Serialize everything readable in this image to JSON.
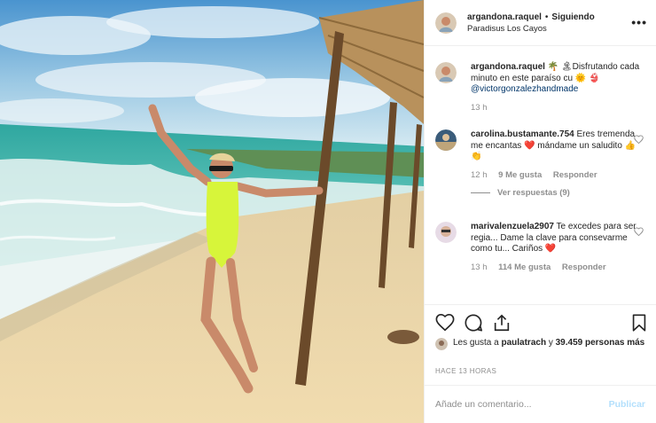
{
  "header": {
    "username": "argandona.raquel",
    "separator": "•",
    "follow_status": "Siguiendo",
    "location": "Paradisus Los Cayos",
    "more_glyph": "•••"
  },
  "caption": {
    "username": "argandona.raquel",
    "text_a": " 🌴 🏝Disfrutando cada minuto en este paraíso cu ",
    "emoji_tail": "🌞 👙",
    "mention": "@victorgonzalezhandmade",
    "time": "13 h"
  },
  "comments": [
    {
      "username": "carolina.bustamante.754",
      "text": " Eres tremenda me encantas ❤️ mándame un saludito 👍👏",
      "time": "12 h",
      "likes": "9 Me gusta",
      "reply": "Responder",
      "view_replies": "Ver respuestas (9)"
    },
    {
      "username": "marivalenzuela2907",
      "text": " Te excedes para ser regia... Dame la clave para consevarme como tu... Cariños ❤️",
      "time": "13 h",
      "likes": "114 Me gusta",
      "reply": "Responder"
    }
  ],
  "actions": {
    "like_icon": "heart-outline",
    "comment_icon": "speech-bubble",
    "share_icon": "share-arrow",
    "save_icon": "bookmark"
  },
  "likes": {
    "prefix": "Les gusta a ",
    "user": "paulatrach",
    "connector": " y",
    "count": "39.459 personas más"
  },
  "posted_ago": "HACE 13 HORAS",
  "composer": {
    "placeholder": "Añade un comentario...",
    "publish": "Publicar"
  },
  "colors": {
    "swimsuit": "#d7f53a",
    "sea": "#3fb8a8",
    "sky": "#5aa6d6",
    "sand": "#e9d6ac",
    "publish_disabled": "#b2dffc",
    "link": "#003569"
  }
}
